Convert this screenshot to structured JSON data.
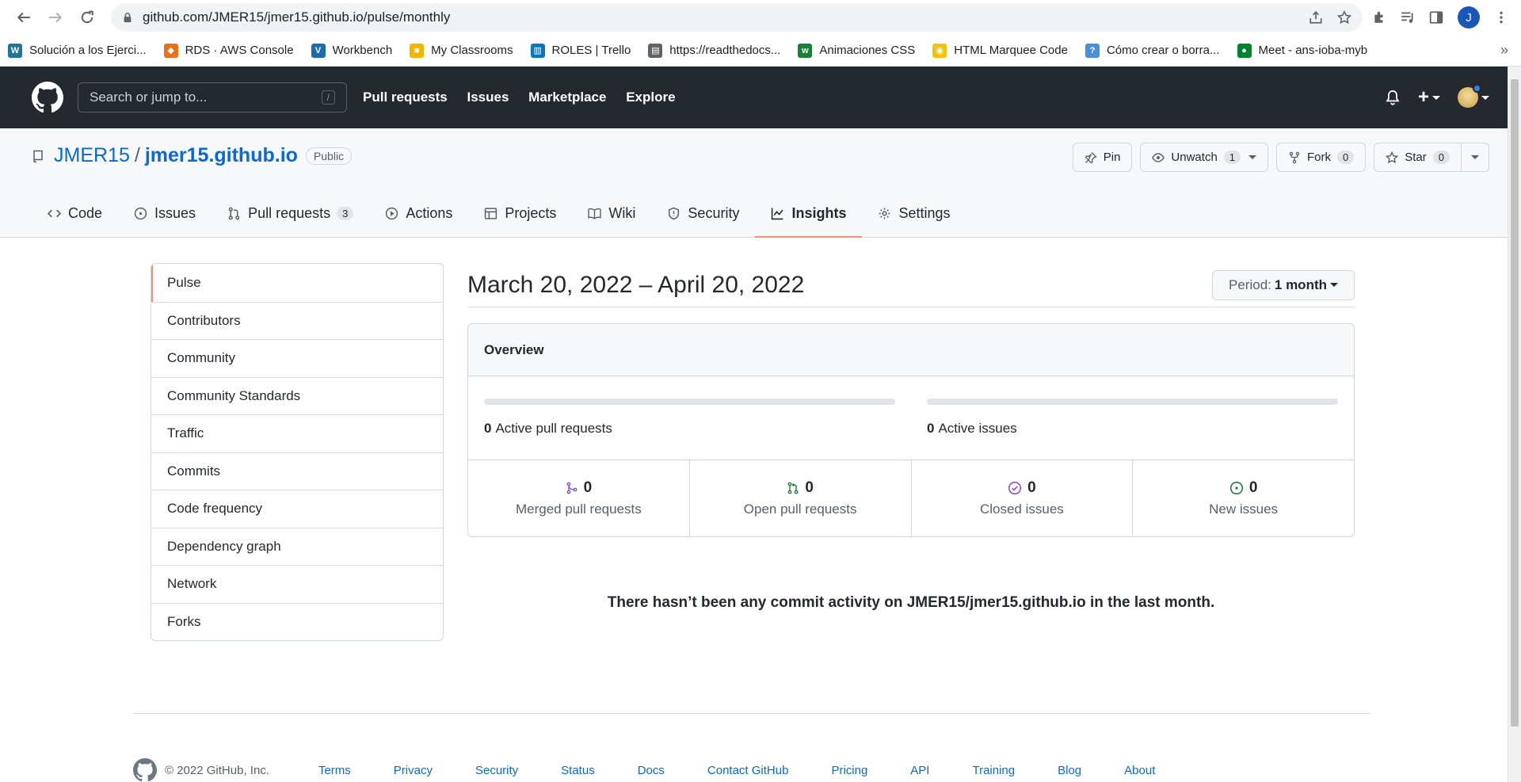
{
  "browser": {
    "url": "github.com/JMER15/jmer15.github.io/pulse/monthly",
    "profile_initial": "J",
    "bookmarks": [
      {
        "label": "Solución a los Ejerci...",
        "color": "#21759b",
        "glyph": "W"
      },
      {
        "label": "RDS · AWS Console",
        "color": "#e8711a",
        "glyph": "◆"
      },
      {
        "label": "Workbench",
        "color": "#1b6cb0",
        "glyph": "V"
      },
      {
        "label": "My Classrooms",
        "color": "#f4b400",
        "glyph": "■"
      },
      {
        "label": "ROLES | Trello",
        "color": "#0079bf",
        "glyph": "▥"
      },
      {
        "label": "https://readthedocs...",
        "color": "#5f6368",
        "glyph": "▤"
      },
      {
        "label": "Animaciones CSS",
        "color": "#1a7f37",
        "glyph": "w"
      },
      {
        "label": "HTML Marquee Code",
        "color": "#f4c20d",
        "glyph": "◉"
      },
      {
        "label": "Cómo crear o borra...",
        "color": "#4a90d9",
        "glyph": "?"
      },
      {
        "label": "Meet - ans-ioba-myb",
        "color": "#00832d",
        "glyph": "●"
      }
    ],
    "more_label": "»"
  },
  "gh_header": {
    "search_placeholder": "Search or jump to...",
    "search_key": "/",
    "nav": [
      "Pull requests",
      "Issues",
      "Marketplace",
      "Explore"
    ],
    "plus_label": "+"
  },
  "repo": {
    "owner": "JMER15",
    "separator": "/",
    "name": "jmer15.github.io",
    "visibility": "Public",
    "pin_label": "Pin",
    "unwatch_label": "Unwatch",
    "unwatch_count": "1",
    "fork_label": "Fork",
    "fork_count": "0",
    "star_label": "Star",
    "star_count": "0"
  },
  "tabs": [
    {
      "label": "Code",
      "icon": "code-icon"
    },
    {
      "label": "Issues",
      "icon": "issue-icon"
    },
    {
      "label": "Pull requests",
      "icon": "pull-request-icon",
      "count": "3"
    },
    {
      "label": "Actions",
      "icon": "play-icon"
    },
    {
      "label": "Projects",
      "icon": "table-icon"
    },
    {
      "label": "Wiki",
      "icon": "book-icon"
    },
    {
      "label": "Security",
      "icon": "shield-icon"
    },
    {
      "label": "Insights",
      "icon": "graph-icon",
      "active": true
    },
    {
      "label": "Settings",
      "icon": "gear-icon"
    }
  ],
  "side_menu": [
    "Pulse",
    "Contributors",
    "Community",
    "Community Standards",
    "Traffic",
    "Commits",
    "Code frequency",
    "Dependency graph",
    "Network",
    "Forks"
  ],
  "pulse": {
    "date_range": "March 20, 2022 – April 20, 2022",
    "period_label": "Period:",
    "period_value": "1 month",
    "overview_title": "Overview",
    "active_prs_count": "0",
    "active_prs_label": "Active pull requests",
    "active_issues_count": "0",
    "active_issues_label": "Active issues",
    "stats": [
      {
        "count": "0",
        "label": "Merged pull requests",
        "icon": "git-merge-icon",
        "color": "#8250df"
      },
      {
        "count": "0",
        "label": "Open pull requests",
        "icon": "git-pull-request-icon",
        "color": "#1a7f37"
      },
      {
        "count": "0",
        "label": "Closed issues",
        "icon": "issue-closed-icon",
        "color": "#8250df"
      },
      {
        "count": "0",
        "label": "New issues",
        "icon": "issue-opened-icon",
        "color": "#1a7f37"
      }
    ],
    "no_activity": "There hasn’t been any commit activity on JMER15/jmer15.github.io in the last month."
  },
  "footer": {
    "copyright": "© 2022 GitHub, Inc.",
    "links": [
      "Terms",
      "Privacy",
      "Security",
      "Status",
      "Docs",
      "Contact GitHub",
      "Pricing",
      "API",
      "Training",
      "Blog",
      "About"
    ]
  }
}
